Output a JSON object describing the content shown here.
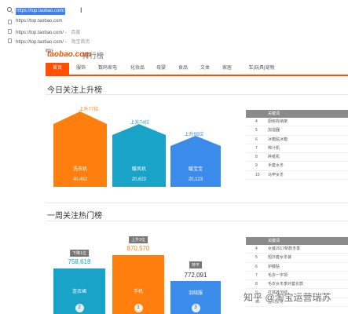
{
  "url_bar": {
    "url": "https://top.taobao.com/",
    "suggestions": [
      {
        "url": "https://top.taobao.com",
        "title": ""
      },
      {
        "url": "https://top.taobao.com/ - ",
        "title": "百度"
      },
      {
        "url": "https://top.taobao.com/ - ",
        "title": "淘宝首页"
      },
      {
        "url": "",
        "title": "发现更多有趣网址"
      }
    ]
  },
  "header": {
    "logo": "taobao.com",
    "logo_sub": "排行榜"
  },
  "nav": {
    "tabs": [
      "首页",
      "服饰",
      "数码家电",
      "化妆品",
      "母婴",
      "食品",
      "文体",
      "家居",
      "车|玩具|宠物"
    ],
    "active": 0
  },
  "section_rising": {
    "title": "今日关注上升榜",
    "items": [
      {
        "name": "洗衣机",
        "value": "40,462",
        "rise": "上升77位",
        "color": "#ff7f0e",
        "rise_color": "#ff7f0e"
      },
      {
        "name": "暖风机",
        "value": "20,622",
        "rise": "上升74位",
        "color": "#1aa3c8",
        "rise_color": "#1aa3c8"
      },
      {
        "name": "暖宝宝",
        "value": "20,123",
        "rise": "上升55位",
        "color": "#3b8bea",
        "rise_color": "#3b8bea"
      }
    ],
    "table": {
      "header": "关键词",
      "rows": [
        {
          "no": "4",
          "name": "厨房收纳架"
        },
        {
          "no": "5",
          "name": "加湿器"
        },
        {
          "no": "6",
          "name": "冰箱贴冰箱"
        },
        {
          "no": "7",
          "name": "榨汁机"
        },
        {
          "no": "8",
          "name": "碎纸机"
        },
        {
          "no": "9",
          "name": "手套女冬"
        },
        {
          "no": "10",
          "name": "马甲女冬"
        }
      ]
    }
  },
  "section_hot": {
    "title": "一周关注热门榜",
    "items": [
      {
        "name": "连衣裙",
        "value": "758,618",
        "tag": "下降1位",
        "rank": "2",
        "color": "#1aa3c8"
      },
      {
        "name": "手机",
        "value": "870,570",
        "tag": "上升2位",
        "rank": "1",
        "color": "#ff7f0e"
      },
      {
        "name": "羽绒服",
        "value": "772,091",
        "tag": "持平",
        "rank": "3",
        "color": "#3b8bea"
      }
    ],
    "table": {
      "header": "关键词",
      "rows": [
        {
          "no": "4",
          "name": "女装2017新款冬季"
        },
        {
          "no": "5",
          "name": "短外套女冬装"
        },
        {
          "no": "6",
          "name": "护膝贴"
        },
        {
          "no": "7",
          "name": "毛衣一字领"
        },
        {
          "no": "8",
          "name": "毛衣女冬季外套长款"
        },
        {
          "no": "9",
          "name": "打底裤加绒"
        },
        {
          "no": "10",
          "name": "围巾女冬"
        }
      ]
    }
  },
  "watermark": "知乎 @淘宝运营瑞苏"
}
